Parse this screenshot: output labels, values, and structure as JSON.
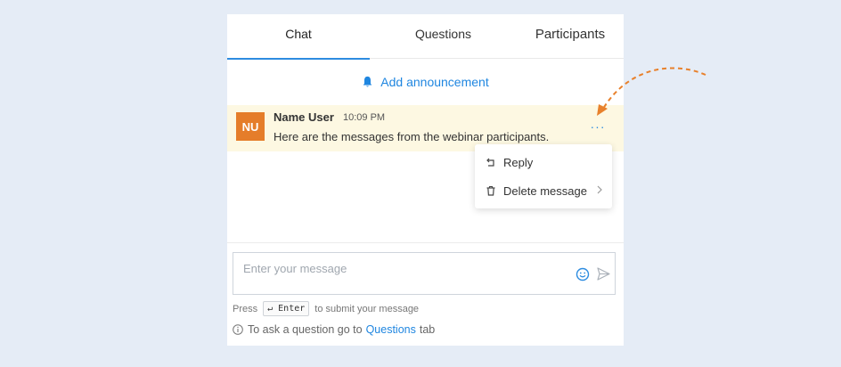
{
  "tabs": [
    {
      "label": "Chat",
      "active": true
    },
    {
      "label": "Questions",
      "active": false
    },
    {
      "label": "Participants",
      "active": false
    }
  ],
  "announcement": {
    "label": "Add announcement",
    "icon": "bell-icon"
  },
  "message": {
    "avatar_initials": "NU",
    "avatar_color": "#e57d2a",
    "author": "Name User",
    "time": "10:09 PM",
    "text": "Here are the messages from the webinar participants.",
    "more_label": "···"
  },
  "context_menu": {
    "reply_label": "Reply",
    "delete_label": "Delete message"
  },
  "composer": {
    "placeholder": "Enter your message",
    "value": ""
  },
  "hint": {
    "press": "Press",
    "key": "↵ Enter",
    "suffix": "to submit your message"
  },
  "info": {
    "prefix": "To ask a question go to",
    "link": "Questions",
    "suffix": "tab"
  },
  "colors": {
    "accent": "#1f86e0",
    "highlight": "#fdf8e2",
    "annotation_arrow": "#e8812c"
  }
}
